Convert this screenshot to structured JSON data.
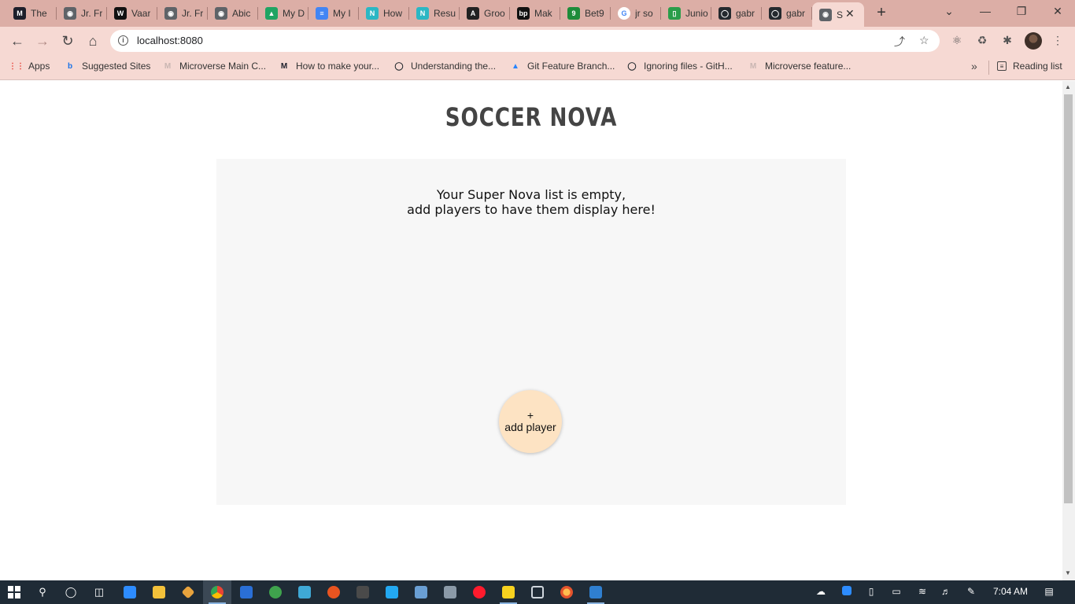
{
  "browser": {
    "tabs": [
      {
        "title": "The",
        "icon": "microverse-icon",
        "color": "#1d1f2b",
        "glyph": "M"
      },
      {
        "title": "Jr. Fr",
        "icon": "globe-icon",
        "color": "#5f6368",
        "glyph": "◉"
      },
      {
        "title": "Vaar",
        "icon": "vaar-icon",
        "color": "#111111",
        "glyph": "W"
      },
      {
        "title": "Jr. Fr",
        "icon": "globe-icon",
        "color": "#5f6368",
        "glyph": "◉"
      },
      {
        "title": "Abic",
        "icon": "globe-icon",
        "color": "#5f6368",
        "glyph": "◉"
      },
      {
        "title": "My D",
        "icon": "google-drive-icon",
        "color": "#1fa463",
        "glyph": "▲"
      },
      {
        "title": "My I",
        "icon": "google-docs-icon",
        "color": "#4285f4",
        "glyph": "≡"
      },
      {
        "title": "How",
        "icon": "notion-n-icon",
        "color": "#2bb7c4",
        "glyph": "N"
      },
      {
        "title": "Resu",
        "icon": "notion-n-icon",
        "color": "#2bb7c4",
        "glyph": "N"
      },
      {
        "title": "Groo",
        "icon": "a-logo-icon",
        "color": "#222222",
        "glyph": "A"
      },
      {
        "title": "Mak",
        "icon": "bp-icon",
        "color": "#111111",
        "glyph": "bp"
      },
      {
        "title": "Bet9",
        "icon": "bet9ja-icon",
        "color": "#1e8c3a",
        "glyph": "9"
      },
      {
        "title": "jr so",
        "icon": "google-g-icon",
        "color": "#ffffff",
        "glyph": "G"
      },
      {
        "title": "Junio",
        "icon": "phone-icon",
        "color": "#2a9d4a",
        "glyph": "▯"
      },
      {
        "title": "gabr",
        "icon": "github-icon",
        "color": "#24292e",
        "glyph": "◯"
      },
      {
        "title": "gabr",
        "icon": "github-icon",
        "color": "#24292e",
        "glyph": "◯"
      },
      {
        "title": "S",
        "icon": "globe-icon",
        "color": "#5f6368",
        "glyph": "◉"
      }
    ],
    "close_glyph": "✕",
    "new_tab_glyph": "+",
    "address": "localhost:8080",
    "bookmarks": [
      {
        "label": "Apps",
        "icon": "apps-grid-icon",
        "glyph": "⋮⋮",
        "color": "#e8453c"
      },
      {
        "label": "Suggested Sites",
        "icon": "bing-icon",
        "glyph": "b",
        "color": "#1a73e8"
      },
      {
        "label": "Microverse Main C...",
        "icon": "microverse-faded-icon",
        "glyph": "M",
        "color": "#c9b6b2"
      },
      {
        "label": "How to make your...",
        "icon": "microverse-icon",
        "glyph": "M",
        "color": "#1d1f2b"
      },
      {
        "label": "Understanding the...",
        "icon": "github-icon",
        "glyph": "◯",
        "color": "#24292e"
      },
      {
        "label": "Git Feature Branch...",
        "icon": "atlassian-icon",
        "glyph": "▲",
        "color": "#2684ff"
      },
      {
        "label": "Ignoring files - GitH...",
        "icon": "github-icon",
        "glyph": "◯",
        "color": "#24292e"
      },
      {
        "label": "Microverse feature...",
        "icon": "microverse-faded-icon",
        "glyph": "M",
        "color": "#c9b6b2"
      }
    ],
    "reading_list": "Reading list"
  },
  "page": {
    "title": "SOCCER NOVA",
    "empty_line1": "Your Super Nova list is empty,",
    "empty_line2": "add players to have them display here!",
    "add_button_plus": "+",
    "add_button_label": "add player",
    "accent_color": "#fde3c3",
    "card_color": "#f7f7f7"
  },
  "taskbar": {
    "clock": "7:04 AM"
  }
}
